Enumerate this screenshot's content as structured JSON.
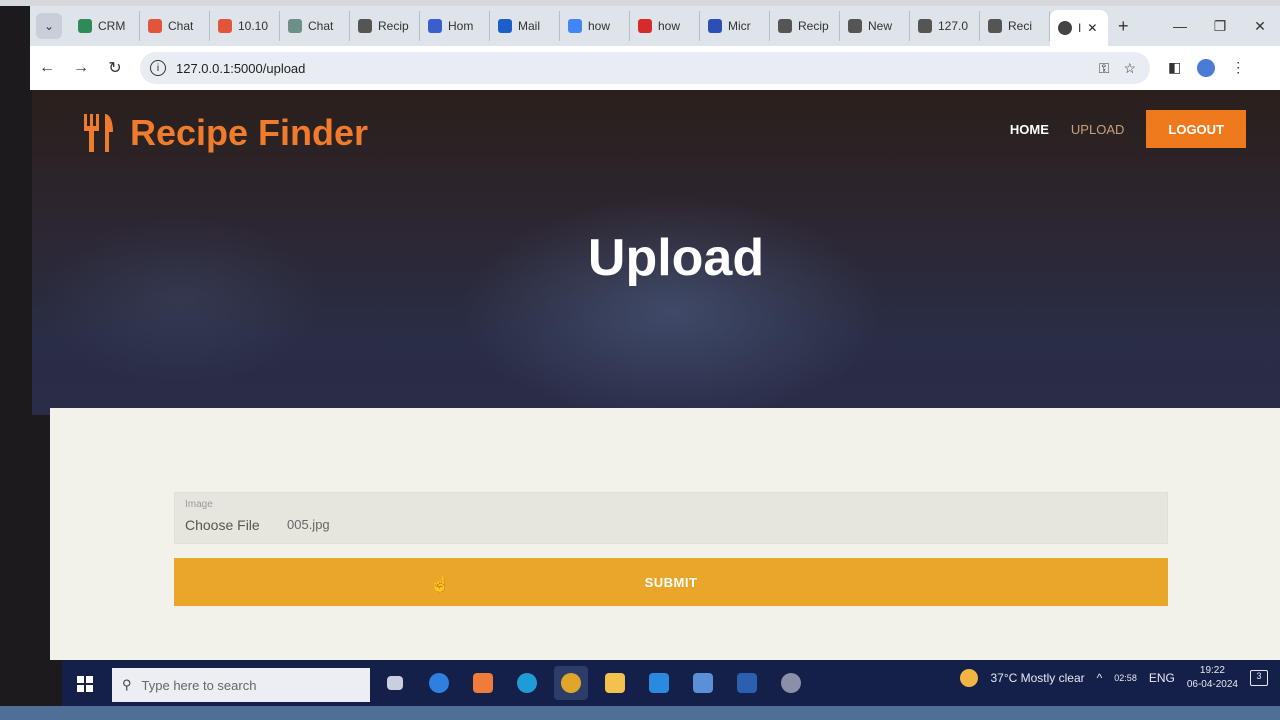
{
  "browser": {
    "tabs": [
      {
        "label": "CRM",
        "icon": "crm-icon",
        "color": "#2e8b57"
      },
      {
        "label": "Chat",
        "icon": "xampp-icon",
        "color": "#e0553c"
      },
      {
        "label": "10.10",
        "icon": "xampp-icon",
        "color": "#e0553c"
      },
      {
        "label": "Chat",
        "icon": "chatgpt-icon",
        "color": "#6c8f87"
      },
      {
        "label": "Recip",
        "icon": "globe-icon",
        "color": "#555555"
      },
      {
        "label": "Hom",
        "icon": "globe-icon",
        "color": "#3a5fcd"
      },
      {
        "label": "Mail",
        "icon": "mail-icon",
        "color": "#1d5fc9"
      },
      {
        "label": "how",
        "icon": "google-icon",
        "color": "#4285f4"
      },
      {
        "label": "how",
        "icon": "cube-icon",
        "color": "#d62b2b"
      },
      {
        "label": "Micr",
        "icon": "k-icon",
        "color": "#2b4fb4"
      },
      {
        "label": "Recip",
        "icon": "globe-icon",
        "color": "#555555"
      },
      {
        "label": "New",
        "icon": "globe-icon",
        "color": "#555555"
      },
      {
        "label": "127.0",
        "icon": "globe-icon",
        "color": "#555555"
      },
      {
        "label": "Reci",
        "icon": "globe-icon",
        "color": "#555555"
      }
    ],
    "active_tab_label": "I",
    "url": "127.0.0.1:5000/upload"
  },
  "site": {
    "brand": "Recipe Finder",
    "nav": {
      "home": "HOME",
      "upload": "UPLOAD",
      "logout": "LOGOUT"
    },
    "hero_title": "Upload",
    "form": {
      "file_label": "Image",
      "choose_file": "Choose File",
      "file_name": "005.jpg",
      "submit": "SUBMIT"
    },
    "colors": {
      "brand_orange": "#f07b2c",
      "submit_yellow": "#e9a62a"
    }
  },
  "taskbar": {
    "search_placeholder": "Type here to search",
    "weather": "37°C  Mostly clear",
    "language": "ENG",
    "time": "19:22",
    "date": "06-04-2024",
    "badge": "02:58",
    "notifications": "3"
  }
}
